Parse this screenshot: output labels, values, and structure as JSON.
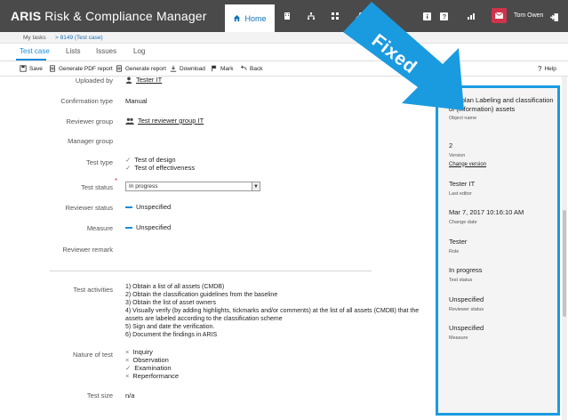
{
  "app": {
    "brand_bold": "ARIS",
    "brand_rest": "Risk & Compliance Manager"
  },
  "topbar": {
    "home_label": "Home",
    "user_name": "Tom Owen"
  },
  "breadcrumb": {
    "item1": "My tasks",
    "item2": "> 8149 (Test case)"
  },
  "tabs": [
    "Test case",
    "Lists",
    "Issues",
    "Log"
  ],
  "toolbar": {
    "save": "Save",
    "pdf": "Generate PDF report",
    "report": "Generate report",
    "download": "Download",
    "mark": "Mark",
    "back": "Back",
    "help": "Help"
  },
  "form": {
    "uploaded_by_label": "Uploaded by",
    "uploaded_by_value": "Tester IT",
    "confirmation_type_label": "Confirmation type",
    "confirmation_type_value": "Manual",
    "reviewer_group_label": "Reviewer group",
    "reviewer_group_value": "Test reviewer group IT",
    "manager_group_label": "Manager group",
    "test_type_label": "Test type",
    "test_type_values": [
      "Test of design",
      "Test of effectiveness"
    ],
    "test_status_label": "Test status",
    "test_status_value": "In progress",
    "reviewer_status_label": "Reviewer status",
    "reviewer_status_value": "Unspecified",
    "measure_label": "Measure",
    "measure_value": "Unspecified",
    "reviewer_remark_label": "Reviewer remark",
    "test_activities_label": "Test activities",
    "test_activities_lines": [
      "1) Obtain a list of all assets (CMDB)",
      "2) Obtain the classification guidelines from the baseline",
      "3) Obtain the list of asset owners",
      "4) Visually verify (by adding highlights, tickmarks and/or comments) at the list of all assets (CMDB) that the assets are labeled according to the classification scheme",
      "5) Sign and date the verification.",
      "6) Document the findings in ARIS"
    ],
    "nature_label": "Nature of test",
    "nature_values": [
      "Inquiry",
      "Observation",
      "Examination",
      "Reperformance"
    ],
    "test_size_label": "Test size",
    "test_size_value": "n/a"
  },
  "panel": {
    "object_name_value": "Testplan Labeling and classification of (information) assets",
    "object_name_label": "Object name",
    "version_value": "2",
    "version_label": "Version",
    "change_version": "Change version",
    "last_editor_value": "Tester IT",
    "last_editor_label": "Last editor",
    "change_date_value": "Mar 7, 2017 10:16:10 AM",
    "change_date_label": "Change date",
    "role_value": "Tester",
    "role_label": "Role",
    "test_status_value": "In progress",
    "test_status_label": "Test status",
    "reviewer_status_value": "Unspecified",
    "reviewer_status_label": "Reviewer status",
    "measure_value": "Unspecified",
    "measure_label": "Measure"
  },
  "annotation": {
    "text": "Fixed",
    "color": "#1a9be0"
  },
  "colors": {
    "topbar": "#4a4a4a",
    "accent": "#1a8cd8",
    "user": "#d0344b"
  }
}
